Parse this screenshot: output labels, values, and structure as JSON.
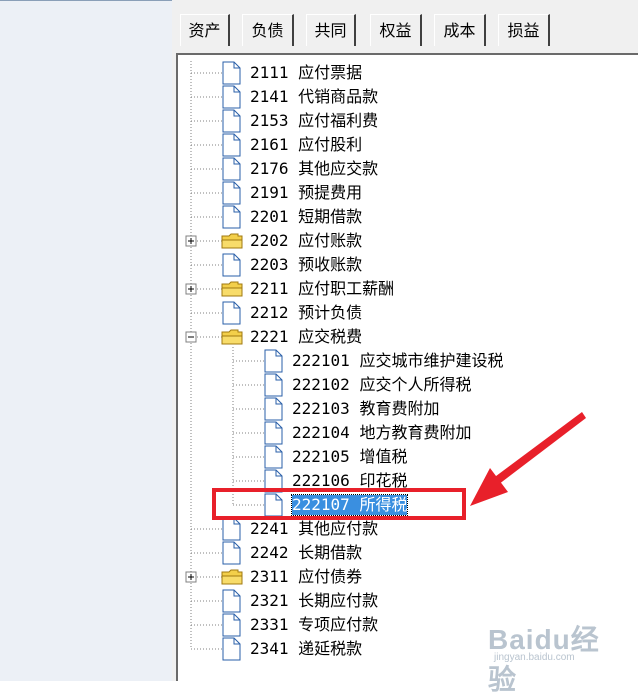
{
  "tabs": [
    {
      "label": "资产"
    },
    {
      "label": "负债",
      "active": true
    },
    {
      "label": "共同"
    },
    {
      "label": "权益"
    },
    {
      "label": "成本"
    },
    {
      "label": "损益"
    }
  ],
  "tree": {
    "nodes": [
      {
        "code": "2111",
        "name": "应付票据",
        "icon": "document-icon",
        "level": 0
      },
      {
        "code": "2141",
        "name": "代销商品款",
        "icon": "document-icon",
        "level": 0
      },
      {
        "code": "2153",
        "name": "应付福利费",
        "icon": "document-icon",
        "level": 0
      },
      {
        "code": "2161",
        "name": "应付股利",
        "icon": "document-icon",
        "level": 0
      },
      {
        "code": "2176",
        "name": "其他应交款",
        "icon": "document-icon",
        "level": 0
      },
      {
        "code": "2191",
        "name": "预提费用",
        "icon": "document-icon",
        "level": 0
      },
      {
        "code": "2201",
        "name": "短期借款",
        "icon": "document-icon",
        "level": 0
      },
      {
        "code": "2202",
        "name": "应付账款",
        "icon": "folder-icon",
        "level": 0,
        "expander": "+"
      },
      {
        "code": "2203",
        "name": "预收账款",
        "icon": "document-icon",
        "level": 0
      },
      {
        "code": "2211",
        "name": "应付职工薪酬",
        "icon": "folder-icon",
        "level": 0,
        "expander": "+"
      },
      {
        "code": "2212",
        "name": "预计负债",
        "icon": "document-icon",
        "level": 0
      },
      {
        "code": "2221",
        "name": "应交税费",
        "icon": "folder-icon",
        "level": 0,
        "expander": "-"
      },
      {
        "code": "222101",
        "name": "应交城市维护建设税",
        "icon": "document-icon",
        "level": 1
      },
      {
        "code": "222102",
        "name": "应交个人所得税",
        "icon": "document-icon",
        "level": 1
      },
      {
        "code": "222103",
        "name": "教育费附加",
        "icon": "document-icon",
        "level": 1
      },
      {
        "code": "222104",
        "name": "地方教育费附加",
        "icon": "document-icon",
        "level": 1
      },
      {
        "code": "222105",
        "name": "增值税",
        "icon": "document-icon",
        "level": 1
      },
      {
        "code": "222106",
        "name": "印花税",
        "icon": "document-icon",
        "level": 1
      },
      {
        "code": "222107",
        "name": "所得税",
        "icon": "document-icon",
        "level": 1,
        "selected": true
      },
      {
        "code": "2241",
        "name": "其他应付款",
        "icon": "document-icon",
        "level": 0
      },
      {
        "code": "2242",
        "name": "长期借款",
        "icon": "document-icon",
        "level": 0
      },
      {
        "code": "2311",
        "name": "应付债券",
        "icon": "folder-icon",
        "level": 0,
        "expander": "+"
      },
      {
        "code": "2321",
        "name": "长期应付款",
        "icon": "document-icon",
        "level": 0
      },
      {
        "code": "2331",
        "name": "专项应付款",
        "icon": "document-icon",
        "level": 0
      },
      {
        "code": "2341",
        "name": "递延税款",
        "icon": "document-icon",
        "level": 0
      }
    ]
  },
  "annotation": {
    "color": "#e8202a",
    "icon": "red-arrow-icon"
  },
  "watermark": {
    "main": "Baidu经验",
    "sub": "jingyan.baidu.com"
  }
}
